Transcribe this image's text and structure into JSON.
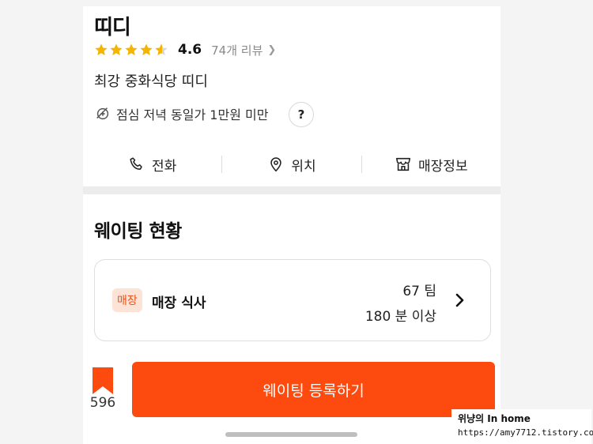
{
  "store": {
    "name": "띠디",
    "rating": 4.6,
    "rating_text": "4.6",
    "stars_filled_fraction": 0.9,
    "review_text": "74개 리뷰",
    "description": "최강 중화식당 띠디",
    "price_text": "점심 저녁 동일가 1만원 미만",
    "help_label": "?"
  },
  "actions": [
    {
      "label": "전화",
      "icon": "phone-icon"
    },
    {
      "label": "위치",
      "icon": "location-pin-icon"
    },
    {
      "label": "매장정보",
      "icon": "store-icon"
    }
  ],
  "waiting": {
    "title": "웨이팅 현황",
    "badge": "매장",
    "type_label": "매장 식사",
    "teams": "67 팀",
    "wait_time": "180 분 이상"
  },
  "footer": {
    "bookmark_count": "596",
    "button_label": "웨이팅 등록하기"
  },
  "watermark": {
    "line1": "위냥의 In home",
    "line2": "https://amy7712.tistory.com"
  },
  "colors": {
    "accent": "#fd4a0e",
    "star": "#f5b400",
    "badge_bg": "#fde3d6",
    "badge_text": "#e8541c"
  }
}
